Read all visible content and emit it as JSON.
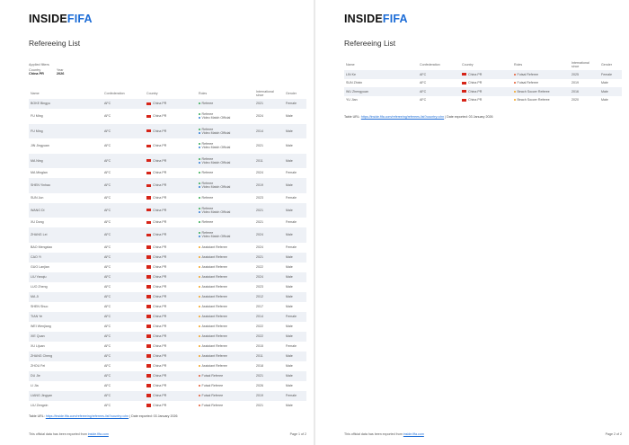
{
  "brand": {
    "inside": "INSIDE",
    "fifa": "FIFA"
  },
  "title": "Refereeing List",
  "filters": {
    "heading": "Applied filters",
    "country_label": "Country",
    "year_label": "Year",
    "country_value": "China PR",
    "year_value": "2026"
  },
  "columns": {
    "name": "Name",
    "confederation": "Confederation",
    "country": "Country",
    "roles": "Roles",
    "intl_since_1": "International",
    "intl_since_2": "since",
    "gender": "Gender"
  },
  "colors": {
    "referee": "#2fa84f",
    "assistant": "#f2a01c",
    "var": "#2a7ad6",
    "futsal": "#e4572e",
    "flag": "#d62418"
  },
  "page1_rows": [
    {
      "name": "BOKE Bingyu",
      "conf": "AFC",
      "country": "China PR",
      "roles": [
        {
          "label": "Referee",
          "type": "referee"
        }
      ],
      "since": "2021",
      "gender": "Female"
    },
    {
      "name": "FU Ming",
      "conf": "AFC",
      "country": "China PR",
      "roles": [
        {
          "label": "Referee",
          "type": "referee"
        },
        {
          "label": "Video Match Official",
          "type": "var"
        }
      ],
      "since": "2024",
      "gender": "Male"
    },
    {
      "name": "FU Ming",
      "conf": "AFC",
      "country": "China PR",
      "roles": [
        {
          "label": "Referee",
          "type": "referee"
        },
        {
          "label": "Video Match Official",
          "type": "var"
        }
      ],
      "since": "2014",
      "gender": "Male"
    },
    {
      "name": "JIN Jingyuan",
      "conf": "AFC",
      "country": "China PR",
      "roles": [
        {
          "label": "Referee",
          "type": "referee"
        },
        {
          "label": "Video Match Official",
          "type": "var"
        }
      ],
      "since": "2021",
      "gender": "Male"
    },
    {
      "name": "MA Ning",
      "conf": "AFC",
      "country": "China PR",
      "roles": [
        {
          "label": "Referee",
          "type": "referee"
        },
        {
          "label": "Video Match Official",
          "type": "var"
        }
      ],
      "since": "2011",
      "gender": "Male"
    },
    {
      "name": "MA Minglan",
      "conf": "AFC",
      "country": "China PR",
      "roles": [
        {
          "label": "Referee",
          "type": "referee"
        }
      ],
      "since": "2024",
      "gender": "Female"
    },
    {
      "name": "SHEN Yinhao",
      "conf": "AFC",
      "country": "China PR",
      "roles": [
        {
          "label": "Referee",
          "type": "referee"
        },
        {
          "label": "Video Match Official",
          "type": "var"
        }
      ],
      "since": "2019",
      "gender": "Male"
    },
    {
      "name": "SUN Jun",
      "conf": "AFC",
      "country": "China PR",
      "roles": [
        {
          "label": "Referee",
          "type": "referee"
        }
      ],
      "since": "2023",
      "gender": "Female"
    },
    {
      "name": "WANG Di",
      "conf": "AFC",
      "country": "China PR",
      "roles": [
        {
          "label": "Referee",
          "type": "referee"
        },
        {
          "label": "Video Match Official",
          "type": "var"
        }
      ],
      "since": "2021",
      "gender": "Male"
    },
    {
      "name": "XU Dong",
      "conf": "AFC",
      "country": "China PR",
      "roles": [
        {
          "label": "Referee",
          "type": "referee"
        }
      ],
      "since": "2021",
      "gender": "Female"
    },
    {
      "name": "ZHANG Lei",
      "conf": "AFC",
      "country": "China PR",
      "roles": [
        {
          "label": "Referee",
          "type": "referee"
        },
        {
          "label": "Video Match Official",
          "type": "var"
        }
      ],
      "since": "2024",
      "gender": "Male"
    },
    {
      "name": "BAO Mengxiao",
      "conf": "AFC",
      "country": "China PR",
      "roles": [
        {
          "label": "Assistant Referee",
          "type": "assistant"
        }
      ],
      "since": "2024",
      "gender": "Female"
    },
    {
      "name": "CAO Yi",
      "conf": "AFC",
      "country": "China PR",
      "roles": [
        {
          "label": "Assistant Referee",
          "type": "assistant"
        }
      ],
      "since": "2021",
      "gender": "Male"
    },
    {
      "name": "GUO Lanjian",
      "conf": "AFC",
      "country": "China PR",
      "roles": [
        {
          "label": "Assistant Referee",
          "type": "assistant"
        }
      ],
      "since": "2022",
      "gender": "Male"
    },
    {
      "name": "LIU Yanqiu",
      "conf": "AFC",
      "country": "China PR",
      "roles": [
        {
          "label": "Assistant Referee",
          "type": "assistant"
        }
      ],
      "since": "2024",
      "gender": "Male"
    },
    {
      "name": "LUO Zheng",
      "conf": "AFC",
      "country": "China PR",
      "roles": [
        {
          "label": "Assistant Referee",
          "type": "assistant"
        }
      ],
      "since": "2023",
      "gender": "Male"
    },
    {
      "name": "MA Ji",
      "conf": "AFC",
      "country": "China PR",
      "roles": [
        {
          "label": "Assistant Referee",
          "type": "assistant"
        }
      ],
      "since": "2012",
      "gender": "Male"
    },
    {
      "name": "SHEN Shuo",
      "conf": "AFC",
      "country": "China PR",
      "roles": [
        {
          "label": "Assistant Referee",
          "type": "assistant"
        }
      ],
      "since": "2017",
      "gender": "Male"
    },
    {
      "name": "TIAN Ye",
      "conf": "AFC",
      "country": "China PR",
      "roles": [
        {
          "label": "Assistant Referee",
          "type": "assistant"
        }
      ],
      "since": "2014",
      "gender": "Female"
    },
    {
      "name": "WEI Wenjiang",
      "conf": "AFC",
      "country": "China PR",
      "roles": [
        {
          "label": "Assistant Referee",
          "type": "assistant"
        }
      ],
      "since": "2022",
      "gender": "Male"
    },
    {
      "name": "XIE Quan",
      "conf": "AFC",
      "country": "China PR",
      "roles": [
        {
          "label": "Assistant Referee",
          "type": "assistant"
        }
      ],
      "since": "2022",
      "gender": "Male"
    },
    {
      "name": "XU Lijuan",
      "conf": "AFC",
      "country": "China PR",
      "roles": [
        {
          "label": "Assistant Referee",
          "type": "assistant"
        }
      ],
      "since": "2015",
      "gender": "Female"
    },
    {
      "name": "ZHANG Cheng",
      "conf": "AFC",
      "country": "China PR",
      "roles": [
        {
          "label": "Assistant Referee",
          "type": "assistant"
        }
      ],
      "since": "2011",
      "gender": "Male"
    },
    {
      "name": "ZHOU Fei",
      "conf": "AFC",
      "country": "China PR",
      "roles": [
        {
          "label": "Assistant Referee",
          "type": "assistant"
        }
      ],
      "since": "2018",
      "gender": "Male"
    },
    {
      "name": "DU Jie",
      "conf": "AFC",
      "country": "China PR",
      "roles": [
        {
          "label": "Futsal Referee",
          "type": "futsal"
        }
      ],
      "since": "2021",
      "gender": "Male"
    },
    {
      "name": "LI Jia",
      "conf": "AFC",
      "country": "China PR",
      "roles": [
        {
          "label": "Futsal Referee",
          "type": "futsal"
        }
      ],
      "since": "2026",
      "gender": "Male"
    },
    {
      "name": "LIANG Jingyan",
      "conf": "AFC",
      "country": "China PR",
      "roles": [
        {
          "label": "Futsal Referee",
          "type": "futsal"
        }
      ],
      "since": "2019",
      "gender": "Female"
    },
    {
      "name": "LIU Zengxin",
      "conf": "AFC",
      "country": "China PR",
      "roles": [
        {
          "label": "Futsal Referee",
          "type": "futsal"
        }
      ],
      "since": "2021",
      "gender": "Male"
    }
  ],
  "page2_rows": [
    {
      "name": "LIN Ke",
      "conf": "AFC",
      "country": "China PR",
      "roles": [
        {
          "label": "Futsal Referee",
          "type": "futsal"
        }
      ],
      "since": "2025",
      "gender": "Female"
    },
    {
      "name": "SUN Zhixin",
      "conf": "AFC",
      "country": "China PR",
      "roles": [
        {
          "label": "Futsal Referee",
          "type": "futsal"
        }
      ],
      "since": "2019",
      "gender": "Male"
    },
    {
      "name": "WU Zhengyuan",
      "conf": "AFC",
      "country": "China PR",
      "roles": [
        {
          "label": "Beach Soccer Referee",
          "type": "assistant"
        }
      ],
      "since": "2016",
      "gender": "Male"
    },
    {
      "name": "YU Jian",
      "conf": "AFC",
      "country": "China PR",
      "roles": [
        {
          "label": "Beach Soccer Referee",
          "type": "assistant"
        }
      ],
      "since": "2020",
      "gender": "Male"
    }
  ],
  "table_url_label": "Table URL:",
  "page1_url_link": "https://inside.fifa.com/refereeing/referees-list?country=chn",
  "page1_url_note": "| Date exported: 03 January 2026",
  "page2_url_link": "https://inside.fifa.com/refereeing/referees-list?country=chn",
  "page2_url_note": "| Date exported: 03 January 2026",
  "footer_text": "This official data has been exported from",
  "footer_link": "inside.fifa.com",
  "page1_num": "Page 1 of 2",
  "page2_num": "Page 2 of 2"
}
